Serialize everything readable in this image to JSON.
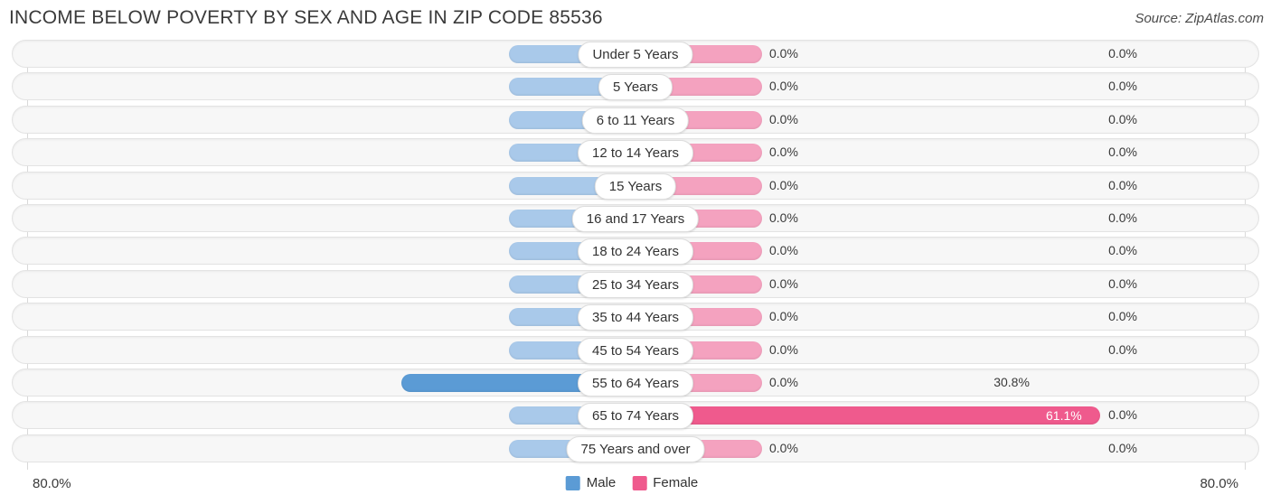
{
  "header": {
    "title": "INCOME BELOW POVERTY BY SEX AND AGE IN ZIP CODE 85536",
    "source": "Source: ZipAtlas.com"
  },
  "axis": {
    "left_label": "80.0%",
    "right_label": "80.0%",
    "max_percent": 80.0
  },
  "legend": {
    "items": [
      {
        "label": "Male",
        "color": "#5b9bd5"
      },
      {
        "label": "Female",
        "color": "#ef5a8d"
      }
    ]
  },
  "colors": {
    "male_zero": "#a9c9ea",
    "female_zero": "#f4a2bf",
    "male_filled": "#5b9bd5",
    "female_filled": "#ef5a8d",
    "track": "#f7f7f7",
    "gridline": "#d9d9d9"
  },
  "chart_data": {
    "type": "bar",
    "title": "INCOME BELOW POVERTY BY SEX AND AGE IN ZIP CODE 85536",
    "subtitle": "Source: ZipAtlas.com",
    "xlabel": "",
    "ylabel": "",
    "orientation": "horizontal-diverging",
    "grid": true,
    "legend_position": "bottom-center",
    "xlim": [
      80.0,
      80.0
    ],
    "axis_left_label": "80.0%",
    "axis_right_label": "80.0%",
    "categories": [
      "Under 5 Years",
      "5 Years",
      "6 to 11 Years",
      "12 to 14 Years",
      "15 Years",
      "16 and 17 Years",
      "18 to 24 Years",
      "25 to 34 Years",
      "35 to 44 Years",
      "45 to 54 Years",
      "55 to 64 Years",
      "65 to 74 Years",
      "75 Years and over"
    ],
    "series": [
      {
        "name": "Male",
        "color": "#5b9bd5",
        "values": [
          0.0,
          0.0,
          0.0,
          0.0,
          0.0,
          0.0,
          0.0,
          0.0,
          0.0,
          0.0,
          30.8,
          0.0,
          0.0
        ],
        "labels": [
          "0.0%",
          "0.0%",
          "0.0%",
          "0.0%",
          "0.0%",
          "0.0%",
          "0.0%",
          "0.0%",
          "0.0%",
          "0.0%",
          "30.8%",
          "0.0%",
          "0.0%"
        ]
      },
      {
        "name": "Female",
        "color": "#ef5a8d",
        "values": [
          0.0,
          0.0,
          0.0,
          0.0,
          0.0,
          0.0,
          0.0,
          0.0,
          0.0,
          0.0,
          0.0,
          61.1,
          0.0
        ],
        "labels": [
          "0.0%",
          "0.0%",
          "0.0%",
          "0.0%",
          "0.0%",
          "0.0%",
          "0.0%",
          "0.0%",
          "0.0%",
          "0.0%",
          "0.0%",
          "61.1%",
          "0.0%"
        ]
      }
    ]
  }
}
